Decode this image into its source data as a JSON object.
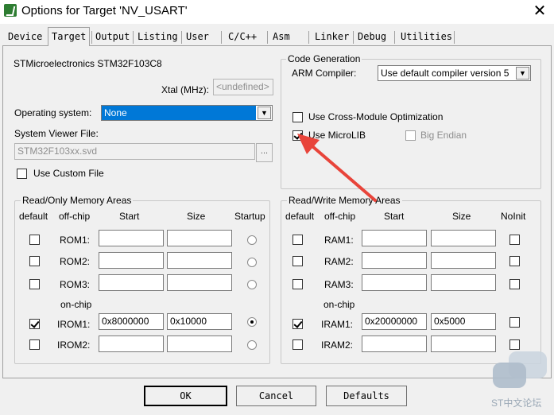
{
  "window": {
    "title": "Options for Target 'NV_USART'"
  },
  "tabs": [
    "Device",
    "Target",
    "Output",
    "Listing",
    "User",
    "C/C++",
    "Asm",
    "Linker",
    "Debug",
    "Utilities"
  ],
  "target": {
    "device_name": "STMicroelectronics STM32F103C8",
    "xtal_label": "Xtal (MHz):",
    "xtal_value": "<undefined>",
    "os_label": "Operating system:",
    "os_value": "None",
    "sysviewer_label": "System Viewer File:",
    "sysviewer_value": "STM32F103xx.svd",
    "use_custom_file_label": "Use Custom File",
    "use_custom_file_checked": false
  },
  "code_gen": {
    "title": "Code Generation",
    "compiler_label": "ARM Compiler:",
    "compiler_value": "Use default compiler version 5",
    "cross_module_label": "Use Cross-Module Optimization",
    "cross_module_checked": false,
    "microlib_label": "Use MicroLIB",
    "microlib_checked": true,
    "big_endian_label": "Big Endian",
    "big_endian_checked": false
  },
  "rom": {
    "title": "Read/Only Memory Areas",
    "headers": {
      "default": "default",
      "offchip": "off-chip",
      "start": "Start",
      "size": "Size",
      "extra": "Startup"
    },
    "onchip_label": "on-chip",
    "rows": [
      {
        "name": "ROM1:",
        "default": false,
        "start": "",
        "size": "",
        "startup": false
      },
      {
        "name": "ROM2:",
        "default": false,
        "start": "",
        "size": "",
        "startup": false
      },
      {
        "name": "ROM3:",
        "default": false,
        "start": "",
        "size": "",
        "startup": false
      },
      {
        "name": "IROM1:",
        "default": true,
        "start": "0x8000000",
        "size": "0x10000",
        "startup": true
      },
      {
        "name": "IROM2:",
        "default": false,
        "start": "",
        "size": "",
        "startup": false
      }
    ]
  },
  "ram": {
    "title": "Read/Write Memory Areas",
    "headers": {
      "default": "default",
      "offchip": "off-chip",
      "start": "Start",
      "size": "Size",
      "extra": "NoInit"
    },
    "onchip_label": "on-chip",
    "rows": [
      {
        "name": "RAM1:",
        "default": false,
        "start": "",
        "size": "",
        "noinit": false
      },
      {
        "name": "RAM2:",
        "default": false,
        "start": "",
        "size": "",
        "noinit": false
      },
      {
        "name": "RAM3:",
        "default": false,
        "start": "",
        "size": "",
        "noinit": false
      },
      {
        "name": "IRAM1:",
        "default": true,
        "start": "0x20000000",
        "size": "0x5000",
        "noinit": false
      },
      {
        "name": "IRAM2:",
        "default": false,
        "start": "",
        "size": "",
        "noinit": false
      }
    ]
  },
  "buttons": {
    "ok": "OK",
    "cancel": "Cancel",
    "defaults": "Defaults"
  },
  "watermark": {
    "text": "ST中文论坛"
  },
  "colors": {
    "selection": "#0078d7",
    "arrow": "#e8443a",
    "window_bg": "#f0f0f0"
  },
  "icons": {
    "app": "keil-uvision-icon",
    "close": "close-icon",
    "annotation": "red-arrow-icon"
  }
}
